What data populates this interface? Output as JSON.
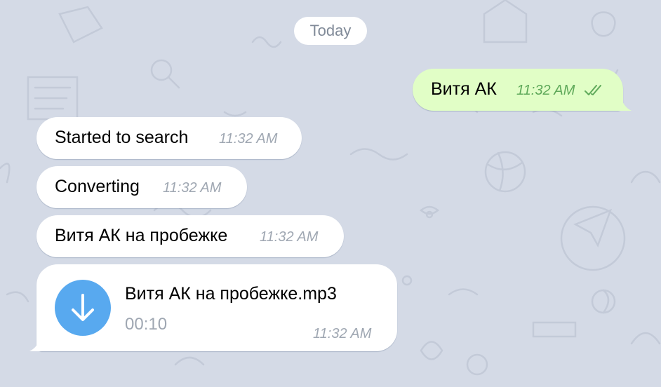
{
  "chat": {
    "date_label": "Today",
    "outgoing": [
      {
        "text": "Витя АК",
        "time": "11:32 AM",
        "status_icon": "double-check-icon"
      }
    ],
    "incoming": [
      {
        "text": "Started to search",
        "time": "11:32 AM"
      },
      {
        "text": "Converting",
        "time": "11:32 AM"
      },
      {
        "text": "Витя АК на пробежке",
        "time": "11:32 AM"
      }
    ],
    "file_message": {
      "name": "Витя АК на пробежке.mp3",
      "duration": "00:10",
      "time": "11:32 AM",
      "icon": "download-arrow-icon"
    }
  },
  "colors": {
    "background": "#d4dae6",
    "incoming_bubble": "#ffffff",
    "outgoing_bubble": "#e1fec6",
    "outgoing_time": "#5fa95a",
    "download_button": "#58a9ef"
  }
}
